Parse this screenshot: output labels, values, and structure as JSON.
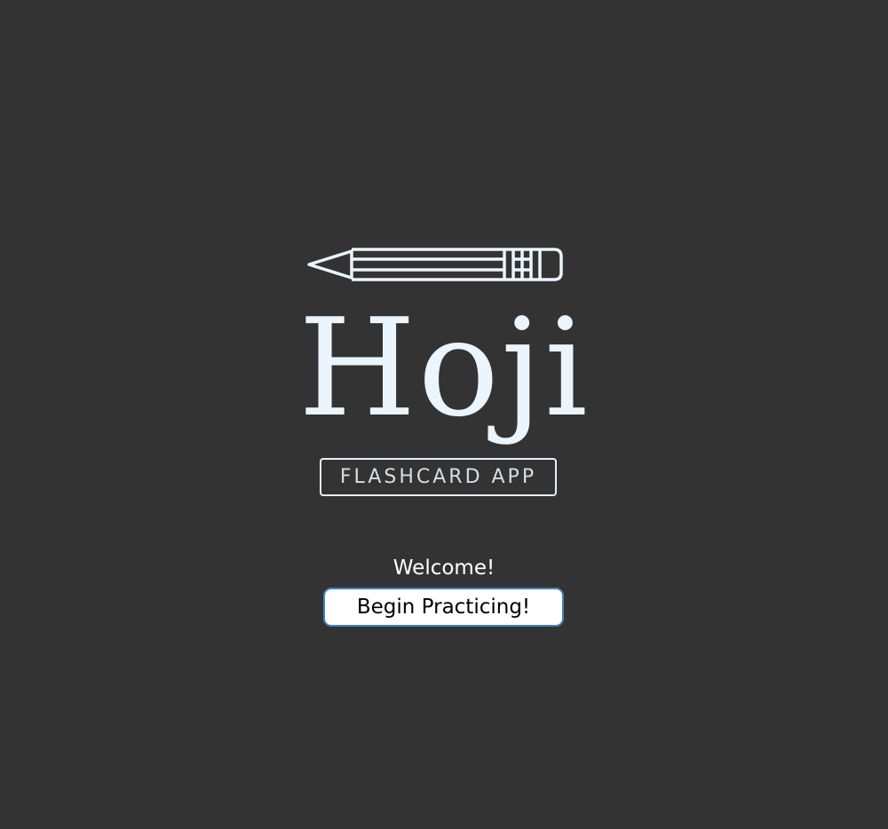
{
  "logo": {
    "brand": "Hoji",
    "tagline": "FLASHCARD APP",
    "icon": "pencil-icon",
    "color": "#eaf5fd"
  },
  "welcome": {
    "message": "Welcome!",
    "button_label": "Begin Practicing!"
  },
  "colors": {
    "background": "#333333",
    "button_border": "#3d82c4"
  }
}
